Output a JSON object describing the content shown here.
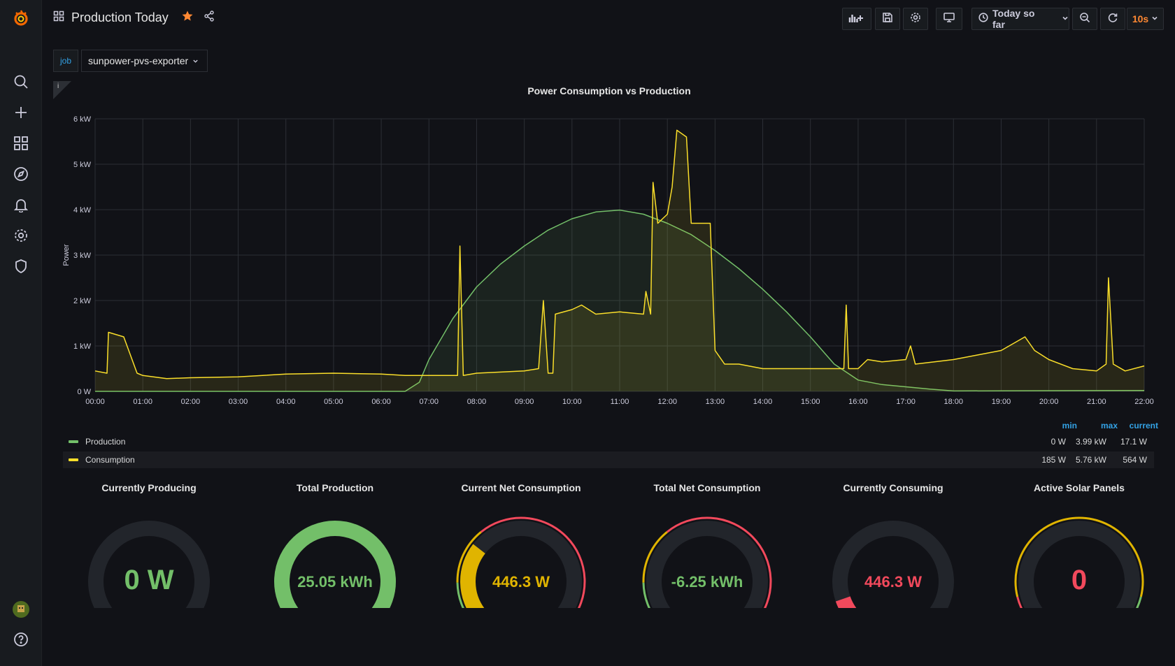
{
  "dashboard": {
    "title": "Production Today",
    "time_range": "Today so far",
    "refresh": "10s"
  },
  "variable": {
    "label": "job",
    "value": "sunpower-pvs-exporter"
  },
  "icons": {
    "logo": "grafana-logo-icon",
    "sidebar": [
      "search-icon",
      "plus-icon",
      "dashboards-icon",
      "explore-compass-icon",
      "alert-bell-icon",
      "gear-icon",
      "shield-icon",
      "avatar",
      "help-icon"
    ],
    "topbar": [
      "add-panel-icon",
      "save-icon",
      "gear-icon",
      "tv-mode-icon",
      "clock-icon",
      "zoom-out-icon",
      "refresh-icon"
    ]
  },
  "colors": {
    "production": "#73bf69",
    "consumption": "#fade2a",
    "red": "#f2495c",
    "blue": "#33a2e5",
    "orange": "#ff8833"
  },
  "chart_data": {
    "type": "line",
    "title": "Power Consumption vs Production",
    "ylabel": "Power",
    "xlabel": "",
    "ylim": [
      0,
      6
    ],
    "y_ticks": [
      "0 W",
      "1 kW",
      "2 kW",
      "3 kW",
      "4 kW",
      "5 kW",
      "6 kW"
    ],
    "x_ticks": [
      "00:00",
      "01:00",
      "02:00",
      "03:00",
      "04:00",
      "05:00",
      "06:00",
      "07:00",
      "08:00",
      "09:00",
      "10:00",
      "11:00",
      "12:00",
      "13:00",
      "14:00",
      "15:00",
      "16:00",
      "17:00",
      "18:00",
      "19:00",
      "20:00",
      "21:00",
      "22:00"
    ],
    "grid": true,
    "legend_placement": "bottom",
    "legend_columns": [
      "min",
      "max",
      "current"
    ],
    "series": [
      {
        "name": "Production",
        "color": "#73bf69",
        "min": "0 W",
        "max": "3.99 kW",
        "current": "17.1 W",
        "points": [
          [
            0,
            0
          ],
          [
            6.5,
            0
          ],
          [
            6.8,
            0.2
          ],
          [
            7,
            0.7
          ],
          [
            7.5,
            1.6
          ],
          [
            8,
            2.3
          ],
          [
            8.5,
            2.8
          ],
          [
            9,
            3.2
          ],
          [
            9.5,
            3.55
          ],
          [
            10,
            3.8
          ],
          [
            10.5,
            3.95
          ],
          [
            11,
            3.99
          ],
          [
            11.5,
            3.9
          ],
          [
            12,
            3.7
          ],
          [
            12.5,
            3.45
          ],
          [
            13,
            3.1
          ],
          [
            13.5,
            2.7
          ],
          [
            14,
            2.25
          ],
          [
            14.5,
            1.75
          ],
          [
            15,
            1.2
          ],
          [
            15.5,
            0.6
          ],
          [
            16,
            0.25
          ],
          [
            16.5,
            0.15
          ],
          [
            17,
            0.1
          ],
          [
            17.5,
            0.05
          ],
          [
            18,
            0.01
          ],
          [
            22,
            0.02
          ]
        ]
      },
      {
        "name": "Consumption",
        "color": "#fade2a",
        "min": "185 W",
        "max": "5.76 kW",
        "current": "564 W",
        "points": [
          [
            0,
            0.45
          ],
          [
            0.25,
            0.4
          ],
          [
            0.28,
            1.3
          ],
          [
            0.6,
            1.2
          ],
          [
            0.88,
            0.4
          ],
          [
            1,
            0.35
          ],
          [
            1.5,
            0.28
          ],
          [
            2,
            0.3
          ],
          [
            3,
            0.32
          ],
          [
            4,
            0.38
          ],
          [
            5,
            0.4
          ],
          [
            6,
            0.38
          ],
          [
            6.5,
            0.35
          ],
          [
            7,
            0.35
          ],
          [
            7.6,
            0.35
          ],
          [
            7.65,
            3.2
          ],
          [
            7.72,
            0.35
          ],
          [
            8,
            0.4
          ],
          [
            9,
            0.45
          ],
          [
            9.3,
            0.5
          ],
          [
            9.4,
            2.0
          ],
          [
            9.5,
            0.4
          ],
          [
            9.6,
            0.4
          ],
          [
            9.65,
            1.7
          ],
          [
            10,
            1.8
          ],
          [
            10.2,
            1.9
          ],
          [
            10.5,
            1.7
          ],
          [
            11,
            1.75
          ],
          [
            11.5,
            1.7
          ],
          [
            11.55,
            2.2
          ],
          [
            11.65,
            1.7
          ],
          [
            11.7,
            4.6
          ],
          [
            11.8,
            3.7
          ],
          [
            12,
            3.9
          ],
          [
            12.1,
            4.5
          ],
          [
            12.2,
            5.75
          ],
          [
            12.4,
            5.6
          ],
          [
            12.5,
            3.7
          ],
          [
            12.9,
            3.7
          ],
          [
            13,
            0.9
          ],
          [
            13.2,
            0.6
          ],
          [
            13.5,
            0.6
          ],
          [
            14,
            0.5
          ],
          [
            15,
            0.5
          ],
          [
            15.7,
            0.5
          ],
          [
            15.75,
            1.9
          ],
          [
            15.8,
            0.5
          ],
          [
            16,
            0.5
          ],
          [
            16.2,
            0.7
          ],
          [
            16.5,
            0.65
          ],
          [
            17,
            0.7
          ],
          [
            17.1,
            1.0
          ],
          [
            17.2,
            0.6
          ],
          [
            18,
            0.7
          ],
          [
            18.5,
            0.8
          ],
          [
            19,
            0.9
          ],
          [
            19.5,
            1.2
          ],
          [
            19.7,
            0.9
          ],
          [
            20,
            0.7
          ],
          [
            20.5,
            0.5
          ],
          [
            21,
            0.45
          ],
          [
            21.2,
            0.6
          ],
          [
            21.25,
            2.5
          ],
          [
            21.35,
            0.6
          ],
          [
            21.6,
            0.45
          ],
          [
            22,
            0.56
          ]
        ]
      }
    ]
  },
  "gauges": [
    {
      "title": "Currently Producing",
      "value": "0 W",
      "color": "#73bf69",
      "fraction": 0.0,
      "track": "none"
    },
    {
      "title": "Total Production",
      "value": "25.05 kWh",
      "color": "#73bf69",
      "fraction": 1.0,
      "track": "none"
    },
    {
      "title": "Current Net Consumption",
      "value": "446.3 W",
      "color": "#e0b400",
      "fraction": 0.3,
      "track": "green-yellow-red"
    },
    {
      "title": "Total Net Consumption",
      "value": "-6.25 kWh",
      "color": "#73bf69",
      "fraction": 0.0,
      "track": "green-yellow-red"
    },
    {
      "title": "Currently Consuming",
      "value": "446.3 W",
      "color": "#f2495c",
      "fraction": 0.08,
      "track": "none"
    },
    {
      "title": "Active Solar Panels",
      "value": "0",
      "color": "#f2495c",
      "fraction": 0.0,
      "track": "red-yellow-green"
    }
  ]
}
